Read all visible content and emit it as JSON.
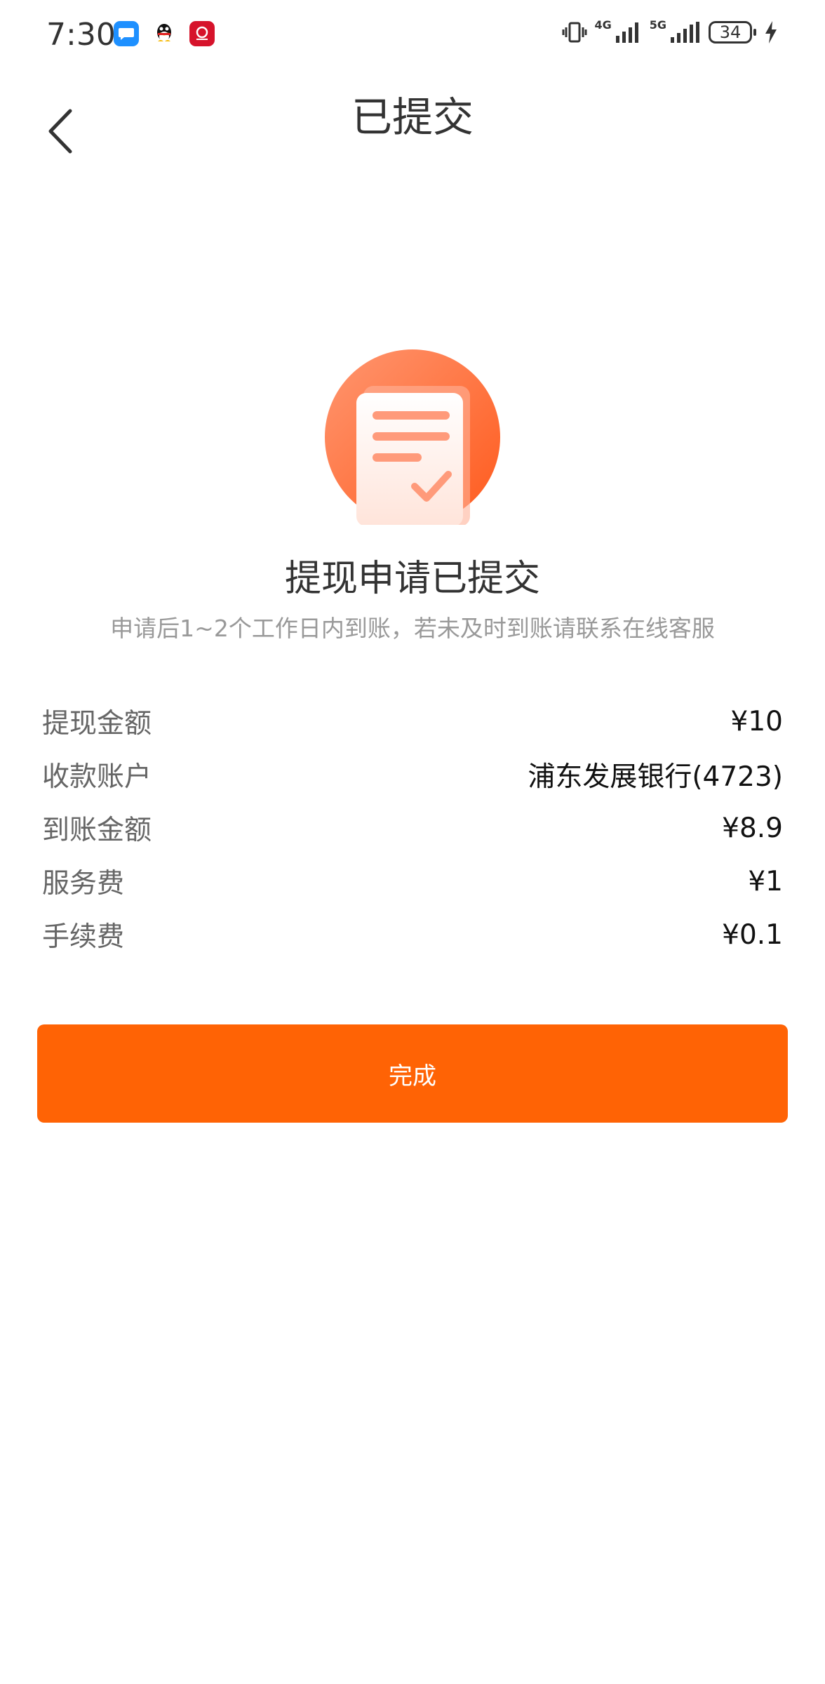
{
  "status_bar": {
    "time": "7:30",
    "network_4g": "4G",
    "network_5g": "5G",
    "battery": "34",
    "app_icons": [
      "message-app-icon",
      "qq-icon",
      "bank-app-icon"
    ]
  },
  "header": {
    "title": "已提交"
  },
  "result": {
    "headline": "提现申请已提交",
    "subtext": "申请后1~2个工作日内到账，若未及时到账请联系在线客服"
  },
  "details": [
    {
      "label": "提现金额",
      "value": "¥10"
    },
    {
      "label": "收款账户",
      "value": "浦东发展银行(4723)"
    },
    {
      "label": "到账金额",
      "value": "¥8.9"
    },
    {
      "label": "服务费",
      "value": "¥1"
    },
    {
      "label": "手续费",
      "value": "¥0.1"
    }
  ],
  "actions": {
    "done_label": "完成"
  },
  "colors": {
    "accent": "#ff6305",
    "icon_gradient_start": "#ff9a70",
    "icon_gradient_end": "#ff5a1f"
  }
}
